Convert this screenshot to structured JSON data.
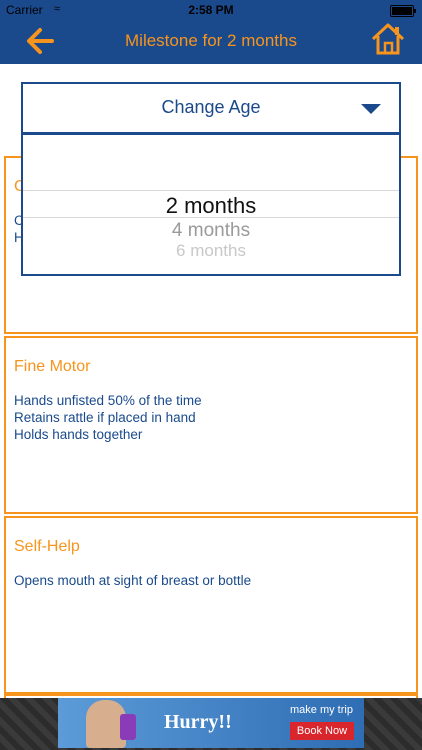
{
  "status_bar": {
    "carrier": "Carrier",
    "time": "2:58 PM"
  },
  "nav": {
    "title": "Milestone for 2 months",
    "accent_color": "#f7941d",
    "bar_color": "#1a4a8c"
  },
  "dropdown": {
    "label": "Change Age",
    "options": [
      "2 months",
      "4 months",
      "6 months"
    ],
    "selected": "2 months"
  },
  "sections": [
    {
      "heading": "C",
      "lines": [
        "C",
        "H"
      ]
    },
    {
      "heading": "Fine Motor",
      "lines": [
        "Hands unfisted 50% of the time",
        "Retains rattle if placed in hand",
        "Holds hands together"
      ]
    },
    {
      "heading": "Self-Help",
      "lines": [
        "Opens mouth at sight of breast or bottle"
      ]
    }
  ],
  "ad": {
    "headline": "Hurry!!",
    "brand": "make my trip",
    "cta": "Book Now"
  }
}
